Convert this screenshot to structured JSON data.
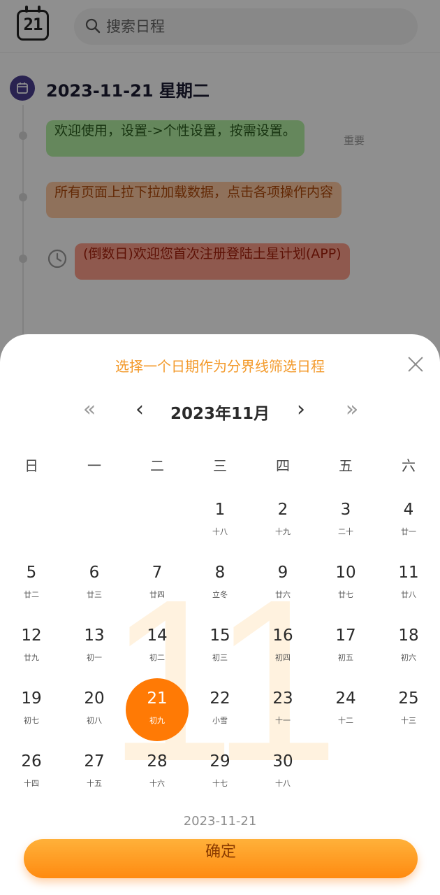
{
  "app": {
    "logo_number": "21",
    "search": {
      "placeholder": "搜索日程"
    },
    "date_heading": "2023-11-21  星期二",
    "events": [
      {
        "text": "欢迎使用，设置->个性设置，按需设置。",
        "tag": "重要",
        "color": "#b4f0a4"
      },
      {
        "text": "所有页面上拉下拉加载数据，点击各项操作内容",
        "color": "#ffc9a3"
      },
      {
        "text": "(倒数日)欢迎您首次注册登陆土星计划(APP)",
        "color": "#ff9f8c",
        "icon": "clock-icon"
      }
    ]
  },
  "picker": {
    "title": "选择一个日期作为分界线筛选日程",
    "nav": {
      "prev_year": "«",
      "prev_month": "‹",
      "month_label": "2023年11月",
      "next_month": "›",
      "next_year": "»"
    },
    "weekdays": [
      "日",
      "一",
      "二",
      "三",
      "四",
      "五",
      "六"
    ],
    "watermark": "11",
    "first_weekday_index": 3,
    "days": [
      {
        "d": "1",
        "l": "十八"
      },
      {
        "d": "2",
        "l": "十九"
      },
      {
        "d": "3",
        "l": "二十"
      },
      {
        "d": "4",
        "l": "廿一"
      },
      {
        "d": "5",
        "l": "廿二"
      },
      {
        "d": "6",
        "l": "廿三"
      },
      {
        "d": "7",
        "l": "廿四"
      },
      {
        "d": "8",
        "l": "立冬"
      },
      {
        "d": "9",
        "l": "廿六"
      },
      {
        "d": "10",
        "l": "廿七"
      },
      {
        "d": "11",
        "l": "廿八"
      },
      {
        "d": "12",
        "l": "廿九"
      },
      {
        "d": "13",
        "l": "初一"
      },
      {
        "d": "14",
        "l": "初二"
      },
      {
        "d": "15",
        "l": "初三"
      },
      {
        "d": "16",
        "l": "初四"
      },
      {
        "d": "17",
        "l": "初五"
      },
      {
        "d": "18",
        "l": "初六"
      },
      {
        "d": "19",
        "l": "初七"
      },
      {
        "d": "20",
        "l": "初八"
      },
      {
        "d": "21",
        "l": "初九"
      },
      {
        "d": "22",
        "l": "小雪"
      },
      {
        "d": "23",
        "l": "十一"
      },
      {
        "d": "24",
        "l": "十二"
      },
      {
        "d": "25",
        "l": "十三"
      },
      {
        "d": "26",
        "l": "十四"
      },
      {
        "d": "27",
        "l": "十五"
      },
      {
        "d": "28",
        "l": "十六"
      },
      {
        "d": "29",
        "l": "十七"
      },
      {
        "d": "30",
        "l": "十八"
      }
    ],
    "selected_day": "21",
    "selected_date": "2023-11-21",
    "confirm_label": "确定",
    "accent_color": "#ff7a05"
  }
}
